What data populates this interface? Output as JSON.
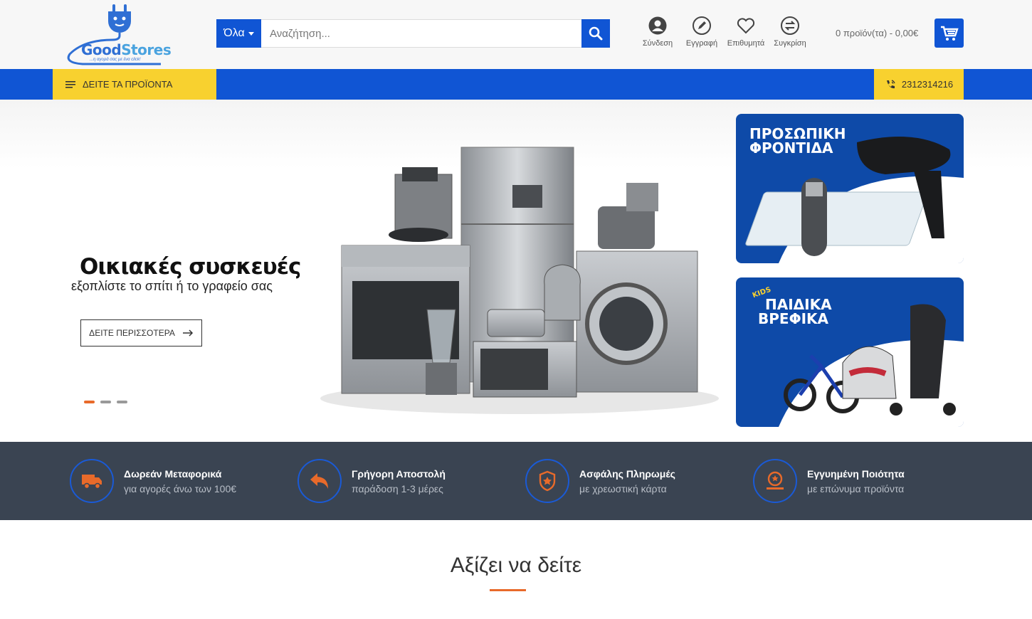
{
  "brand": {
    "name_part1": "Good",
    "name_part2": "Stores",
    "tagline": "...η αγορά σας με ένα click!"
  },
  "search": {
    "category_label": "Όλα",
    "placeholder": "Αναζήτηση..."
  },
  "header_links": [
    {
      "label": "Σύνδεση",
      "icon": "user-icon"
    },
    {
      "label": "Εγγραφή",
      "icon": "pencil-icon"
    },
    {
      "label": "Επιθυμητά",
      "icon": "heart-icon"
    },
    {
      "label": "Συγκρίση",
      "icon": "compare-icon"
    }
  ],
  "cart": {
    "summary": "0 προϊόν(τα) - 0,00€"
  },
  "nav": {
    "products_label": "ΔΕΙΤΕ ΤΑ ΠΡΟΪΟΝΤΑ",
    "phone": "2312314216"
  },
  "hero": {
    "title": "Οικιακές συσκευές",
    "subtitle": "εξοπλίστε το σπίτι ή το γραφείο σας",
    "button_label": "ΔΕΙΤΕ ΠΕΡΙΣΣΟΤΕΡΑ",
    "slides": 3,
    "active_slide": 1
  },
  "promos": [
    {
      "title_line1": "ΠΡΟΣΩΠΙΚΗ",
      "title_line2": "ΦΡΟΝΤΙΔΑ"
    },
    {
      "badge": "KIDS",
      "title_line1": "ΠΑΙΔΙΚΑ",
      "title_line2": "ΒΡΕΦΙΚΑ"
    }
  ],
  "features": [
    {
      "title": "Δωρεάν Μεταφορικά",
      "subtitle": "για αγορές άνω των 100€",
      "icon": "truck-icon"
    },
    {
      "title": "Γρήγορη Αποστολή",
      "subtitle": "παράδοση 1-3 μέρες",
      "icon": "reply-arrow-icon"
    },
    {
      "title": "Ασφάλης Πληρωμές",
      "subtitle": "με χρεωστική κάρτα",
      "icon": "shield-icon"
    },
    {
      "title": "Εγγυημένη Ποιότητα",
      "subtitle": "με επώνυμα προϊόντα",
      "icon": "award-icon"
    }
  ],
  "section": {
    "title": "Αξίζει να δείτε"
  },
  "colors": {
    "primary": "#1055d4",
    "accent_yellow": "#f8d12f",
    "accent_orange": "#e86a2a",
    "features_bg": "#3a4452"
  }
}
